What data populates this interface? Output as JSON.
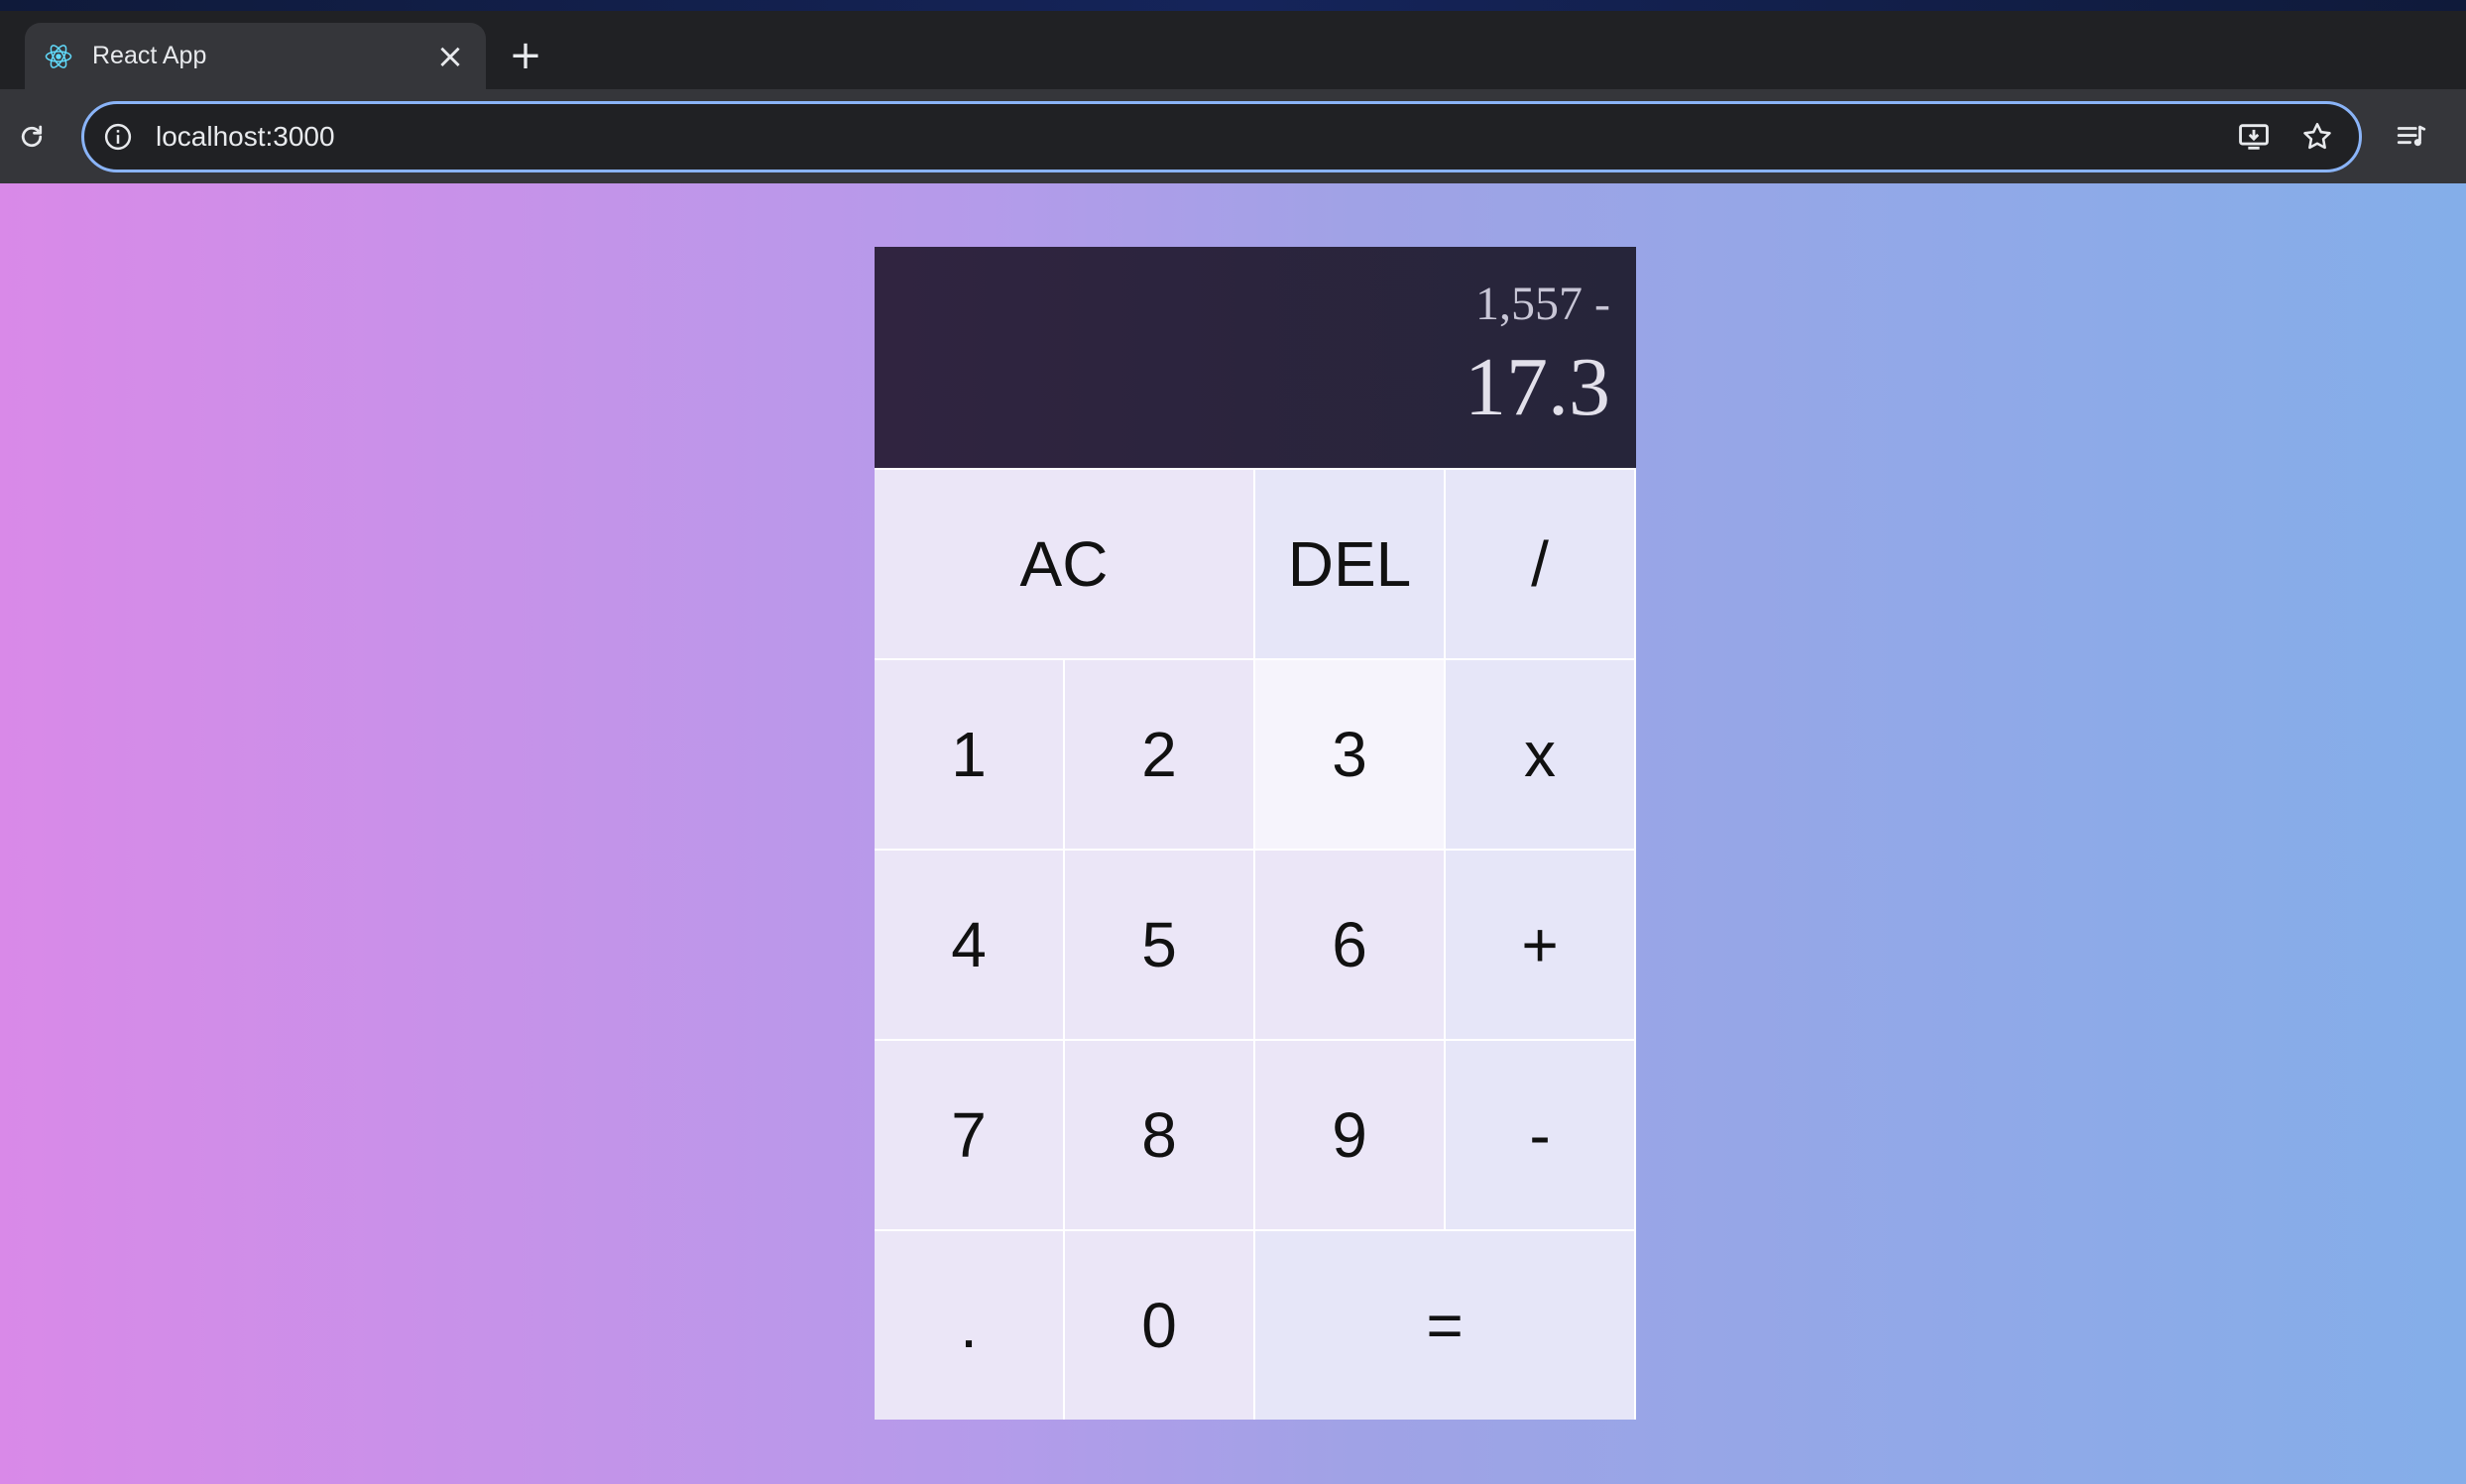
{
  "browser": {
    "tab_title": "React App",
    "tab_favicon": "react-icon",
    "close_icon": "×",
    "new_tab_icon": "+",
    "url": "localhost:3000"
  },
  "calculator": {
    "previous_operand": "1,557 -",
    "current_operand": "17.3",
    "buttons": {
      "ac": "AC",
      "del": "DEL",
      "divide": "/",
      "one": "1",
      "two": "2",
      "three": "3",
      "multiply": "x",
      "four": "4",
      "five": "5",
      "six": "6",
      "plus": "+",
      "seven": "7",
      "eight": "8",
      "nine": "9",
      "minus": "-",
      "dot": ".",
      "zero": "0",
      "equals": "="
    }
  },
  "colors": {
    "display_bg": "#2c2640",
    "button_bg": "#ebe6f7",
    "gradient_left": "#d989e8",
    "gradient_right": "#84aee9"
  }
}
